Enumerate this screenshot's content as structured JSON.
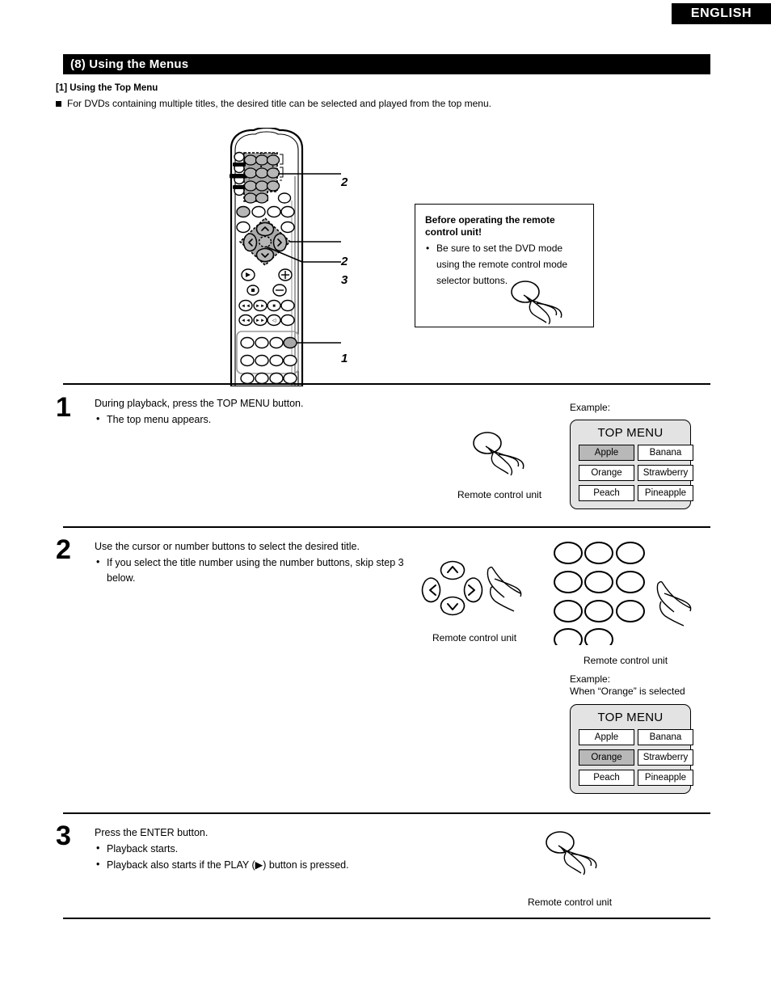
{
  "header": {
    "language_tab": "ENGLISH",
    "section_title": "(8) Using the Menus",
    "subsection_title": "[1] Using the Top Menu",
    "intro_bullet": "For DVDs containing multiple titles, the desired title can be selected and played from the top menu."
  },
  "remote_callouts": {
    "numpad": "2",
    "cursor": "2",
    "enter": "3",
    "topmenu_button": "1"
  },
  "note_box": {
    "title_line1": "Before operating the remote",
    "title_line2": "control unit!",
    "bullet": "Be sure to set the DVD mode using the remote control mode selector buttons.",
    "hand_icon": "pressing-hand-icon"
  },
  "steps": [
    {
      "number": "1",
      "lead": "During playback, press the TOP MENU button.",
      "bullets": [
        "The top menu appears."
      ],
      "caption": "Remote control unit",
      "example_label": "Example:"
    },
    {
      "number": "2",
      "lead": "Use the cursor or number buttons to select the desired title.",
      "bullets": [
        "If you select the title number using the number buttons, skip step 3 below."
      ],
      "caption_cursor": "Remote control unit",
      "caption_numpad": "Remote control unit",
      "example_label_line1": "Example:",
      "example_label_line2": "When “Orange” is selected"
    },
    {
      "number": "3",
      "lead": "Press the ENTER button.",
      "bullets": [
        "Playback starts.",
        "Playback also starts if the PLAY (▶) button is pressed."
      ],
      "caption": "Remote control unit"
    }
  ],
  "top_menu_1": {
    "title": "TOP MENU",
    "items": [
      "Apple",
      "Banana",
      "Orange",
      "Strawberry",
      "Peach",
      "Pineapple"
    ],
    "selected": "Apple"
  },
  "top_menu_2": {
    "title": "TOP MENU",
    "items": [
      "Apple",
      "Banana",
      "Orange",
      "Strawberry",
      "Peach",
      "Pineapple"
    ],
    "selected": "Orange"
  },
  "colors": {
    "bar_background": "#000000",
    "bar_text": "#ffffff",
    "panel_background": "#e3e3e3",
    "cell_background": "#ffffff",
    "selected_cell_background": "#b8b8b8",
    "highlight_gray": "#a8a8a8"
  }
}
